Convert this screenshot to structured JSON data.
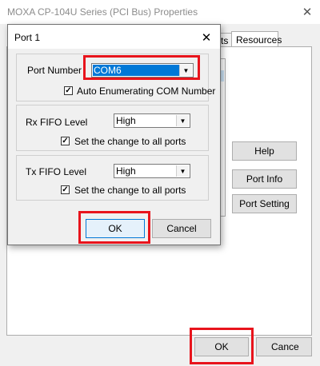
{
  "window": {
    "title": "MOXA CP-104U Series (PCI Bus) Properties",
    "close_glyph": "✕",
    "tabs": [
      {
        "label": "ts"
      },
      {
        "label": "Resources"
      }
    ],
    "side_buttons": {
      "help": "Help",
      "port_info": "Port Info",
      "port_setting": "Port Setting"
    },
    "ok_label": "OK",
    "cancel_label": "Cance"
  },
  "dialog": {
    "title": "Port 1",
    "close_glyph": "✕",
    "port_number": {
      "label": "Port Number",
      "value": "COM6",
      "auto_enum_label": "Auto Enumerating COM Number",
      "auto_enum_checked": true
    },
    "rx_fifo": {
      "label": "Rx FIFO Level",
      "value": "High",
      "apply_all_label": "Set the change to all ports",
      "apply_all_checked": true
    },
    "tx_fifo": {
      "label": "Tx FIFO Level",
      "value": "High",
      "apply_all_label": "Set the change to all ports",
      "apply_all_checked": true
    },
    "ok_label": "OK",
    "cancel_label": "Cancel"
  },
  "colors": {
    "highlight": "#e8141c",
    "selection": "#0078d7"
  }
}
